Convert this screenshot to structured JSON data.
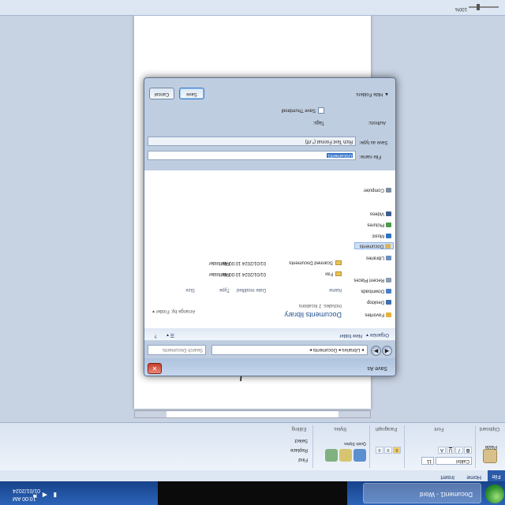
{
  "taskbar": {
    "time": "10:00 AM",
    "date": "01/01/2024",
    "active_window_label": "Document1 - Word"
  },
  "word": {
    "file_tab": "File",
    "tabs": [
      "Home",
      "Insert",
      "Page Layout",
      "References",
      "Mailings",
      "Review",
      "View"
    ],
    "ribbon_groups": [
      "Clipboard",
      "Font",
      "Paragraph",
      "Styles",
      "Editing"
    ],
    "font_name": "Calibri",
    "font_size": "11",
    "paste_label": "Paste",
    "styles_buttons": [
      "Quick Styles",
      "Change Styles"
    ],
    "editing_buttons": [
      "Find",
      "Replace",
      "Select"
    ],
    "zoom_level": "100%"
  },
  "dialog": {
    "title": "Save As",
    "close_symbol": "✕",
    "back_symbol": "◀",
    "forward_symbol": "▶",
    "address_path": "▸ Libraries ▸ Documents ▸",
    "search_placeholder": "Search Documents",
    "toolbar": {
      "organize": "Organize ▾",
      "new_folder": "New folder"
    },
    "nav_items": [
      {
        "label": "Favorites",
        "color": "#e6b13b"
      },
      {
        "label": "Desktop",
        "color": "#3d6fb0"
      },
      {
        "label": "Downloads",
        "color": "#4a7fc4"
      },
      {
        "label": "Recent Places",
        "color": "#8a9bb5"
      },
      {
        "label": "Libraries",
        "color": "#6a8fc0"
      },
      {
        "label": "Documents",
        "color": "#d9b55a"
      },
      {
        "label": "Music",
        "color": "#2b73c6"
      },
      {
        "label": "Pictures",
        "color": "#4c9a4c"
      },
      {
        "label": "Videos",
        "color": "#3c5e8e"
      },
      {
        "label": "Computer",
        "color": "#7c8ba3"
      }
    ],
    "library_title": "Documents library",
    "library_subtitle": "Includes: 2 locations",
    "arrange_label": "Arrange by:",
    "arrange_value": "Folder ▾",
    "columns": [
      "Name",
      "Date modified",
      "Type",
      "Size"
    ],
    "files": [
      {
        "name": "Fax",
        "date": "01/01/2024 10:00 AM",
        "type": "File folder"
      },
      {
        "name": "Scanned Documents",
        "date": "01/01/2024 10:00 AM",
        "type": "File folder"
      }
    ],
    "file_name_label": "File name:",
    "file_name_value": "Document1",
    "save_type_label": "Save as type:",
    "save_type_value": "Rich Text Format (*.rtf)",
    "authors_label": "Authors:",
    "tags_label": "Tags:",
    "thumbnail_label": "Save Thumbnail",
    "hide_folders": "Hide Folders",
    "save_button": "Save",
    "cancel_button": "Cancel"
  }
}
